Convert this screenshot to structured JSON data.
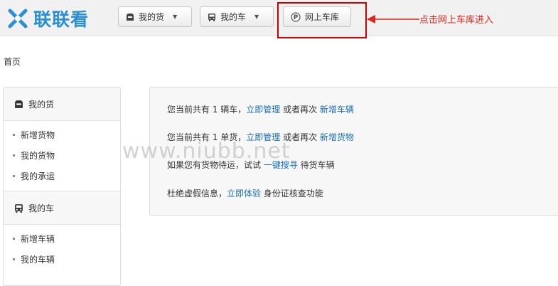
{
  "app": {
    "logo_text": "联联看"
  },
  "nav": {
    "my_cargo": "我的货",
    "my_car": "我的车",
    "online_garage": "网上车库"
  },
  "annotation": {
    "text": "点击网上车库进入"
  },
  "breadcrumb": "首页",
  "sidebar": {
    "cargo_header": "我的货",
    "cargo_items": [
      "新增货物",
      "我的货物",
      "我的承运"
    ],
    "car_header": "我的车",
    "car_items": [
      "新增车辆",
      "我的车辆"
    ]
  },
  "main": {
    "line1": {
      "pre": "您当前共有 1 辆车，",
      "link1": "立即管理",
      "mid": " 或者再次 ",
      "link2": "新增车辆"
    },
    "line2": {
      "pre": "您当前共有 1 单货，",
      "link1": "立即管理",
      "mid": " 或者再次 ",
      "link2": "新增货物"
    },
    "line3": {
      "pre": "如果您有货物待运，试试 ",
      "link": "一键搜寻",
      "post": " 待货车辆"
    },
    "line4": {
      "pre": "杜绝虚假信息，",
      "link": "立即体验",
      "post": " 身份证核查功能"
    }
  },
  "watermark": "www.niubb.net",
  "colors": {
    "accent": "#2a8fd4",
    "link": "#1a6fb6",
    "highlight": "#d10000"
  }
}
